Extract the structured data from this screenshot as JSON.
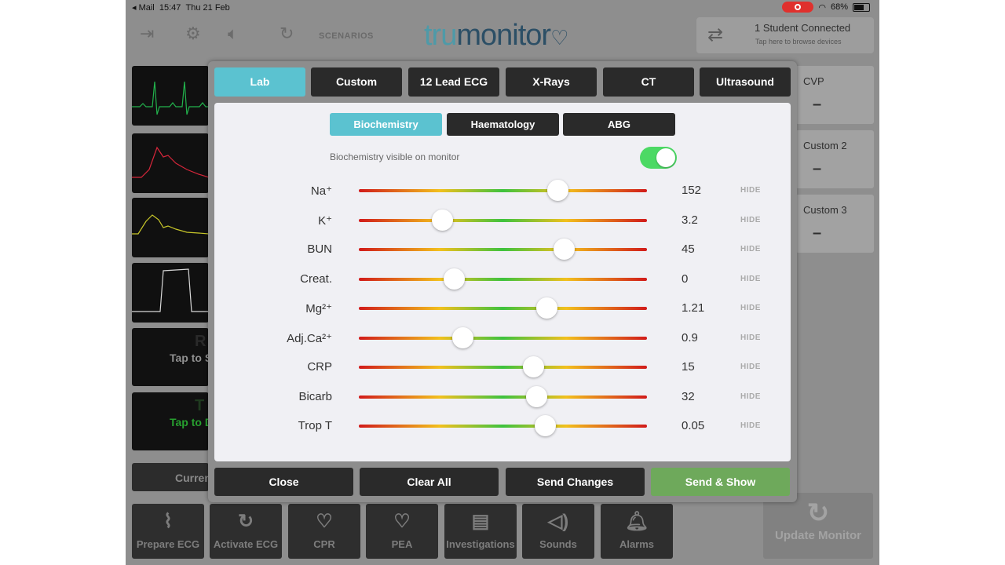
{
  "status_bar": {
    "back_app": "◂ Mail",
    "time": "15:47",
    "date": "Thu 21 Feb",
    "battery": "68%"
  },
  "topbar": {
    "scenarios": "SCENARIOS",
    "logo_a": "tru",
    "logo_b": "monitor",
    "connected": "1 Student Connected",
    "connected_hint": "Tap here to browse devices"
  },
  "left": {
    "tap1_big": "R",
    "tap1_text": "Tap to S",
    "tap2_big": "T",
    "tap2_text": "Tap to Di",
    "current": "Curren"
  },
  "right_cards": [
    {
      "name": "CVP",
      "value": "–"
    },
    {
      "name": "Custom 2",
      "value": "–"
    },
    {
      "name": "Custom 3",
      "value": "–"
    }
  ],
  "bottom_buttons": [
    {
      "label": "Prepare ECG",
      "icon": "ecg-wave-icon"
    },
    {
      "label": "Activate ECG",
      "icon": "refresh-icon"
    },
    {
      "label": "CPR",
      "icon": "heart-pulse-icon"
    },
    {
      "label": "PEA",
      "icon": "heart-pulse-icon"
    },
    {
      "label": "Investigations",
      "icon": "clipboard-icon"
    },
    {
      "label": "Sounds",
      "icon": "speaker-icon"
    },
    {
      "label": "Alarms",
      "icon": "bell-icon"
    }
  ],
  "update_monitor": "Update Monitor",
  "modal": {
    "tabs": [
      "Lab",
      "Custom",
      "12 Lead ECG",
      "X-Rays",
      "CT",
      "Ultrasound"
    ],
    "active_tab": "Lab",
    "subtabs": [
      "Biochemistry",
      "Haematology",
      "ABG"
    ],
    "active_subtab": "Biochemistry",
    "visible_label": "Biochemistry visible on monitor",
    "visible_on": true,
    "hide_label": "HIDE",
    "rows": [
      {
        "label": "Na⁺",
        "value": "152",
        "pos": 0.69
      },
      {
        "label": "K⁺",
        "value": "3.2",
        "pos": 0.29
      },
      {
        "label": "BUN",
        "value": "45",
        "pos": 0.71
      },
      {
        "label": "Creat.",
        "value": "0",
        "pos": 0.33
      },
      {
        "label": "Mg²⁺",
        "value": "1.21",
        "pos": 0.65
      },
      {
        "label": "Adj.Ca²⁺",
        "value": "0.9",
        "pos": 0.36
      },
      {
        "label": "CRP",
        "value": "15",
        "pos": 0.605
      },
      {
        "label": "Bicarb",
        "value": "32",
        "pos": 0.615
      },
      {
        "label": "Trop T",
        "value": "0.05",
        "pos": 0.645
      }
    ],
    "footer": [
      "Close",
      "Clear All",
      "Send Changes",
      "Send & Show"
    ]
  }
}
